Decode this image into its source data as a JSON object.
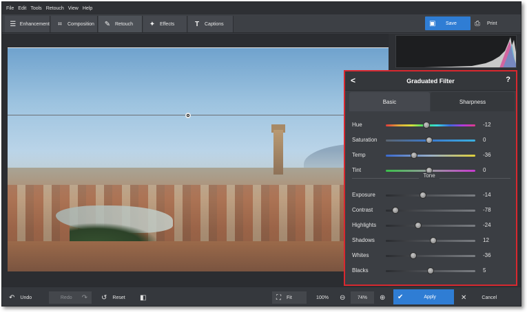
{
  "menu": [
    "File",
    "Edit",
    "Tools",
    "Retouch",
    "View",
    "Help"
  ],
  "tabs": [
    {
      "label": "Enhancement",
      "icon": "sliders-icon"
    },
    {
      "label": "Composition",
      "icon": "crop-icon"
    },
    {
      "label": "Retouch",
      "icon": "brush-icon"
    },
    {
      "label": "Effects",
      "icon": "magic-wand-icon"
    },
    {
      "label": "Captions",
      "icon": "text-icon"
    }
  ],
  "toolbar": {
    "save_label": "Save",
    "print_label": "Print"
  },
  "panel": {
    "title": "Graduated Filter",
    "back": "<",
    "help": "?",
    "tabs": {
      "basic": "Basic",
      "sharpness": "Sharpness"
    },
    "tone_header": "Tone",
    "sliders": [
      {
        "label": "Hue",
        "value": "-12"
      },
      {
        "label": "Saturation",
        "value": "0"
      },
      {
        "label": "Temp",
        "value": "-36"
      },
      {
        "label": "Tint",
        "value": "0"
      },
      {
        "label": "Exposure",
        "value": "-14"
      },
      {
        "label": "Contrast",
        "value": "-78"
      },
      {
        "label": "Highlights",
        "value": "-24"
      },
      {
        "label": "Shadows",
        "value": "12"
      },
      {
        "label": "Whites",
        "value": "-36"
      },
      {
        "label": "Blacks",
        "value": "5"
      }
    ]
  },
  "bottom": {
    "undo": "Undo",
    "redo": "Redo",
    "reset": "Reset",
    "fit": "Fit",
    "zoom100": "100%",
    "zoom": "74%",
    "apply": "Apply",
    "cancel": "Cancel"
  },
  "colors": {
    "accent": "#2f7dd4",
    "highlight_border": "#d9282f"
  }
}
